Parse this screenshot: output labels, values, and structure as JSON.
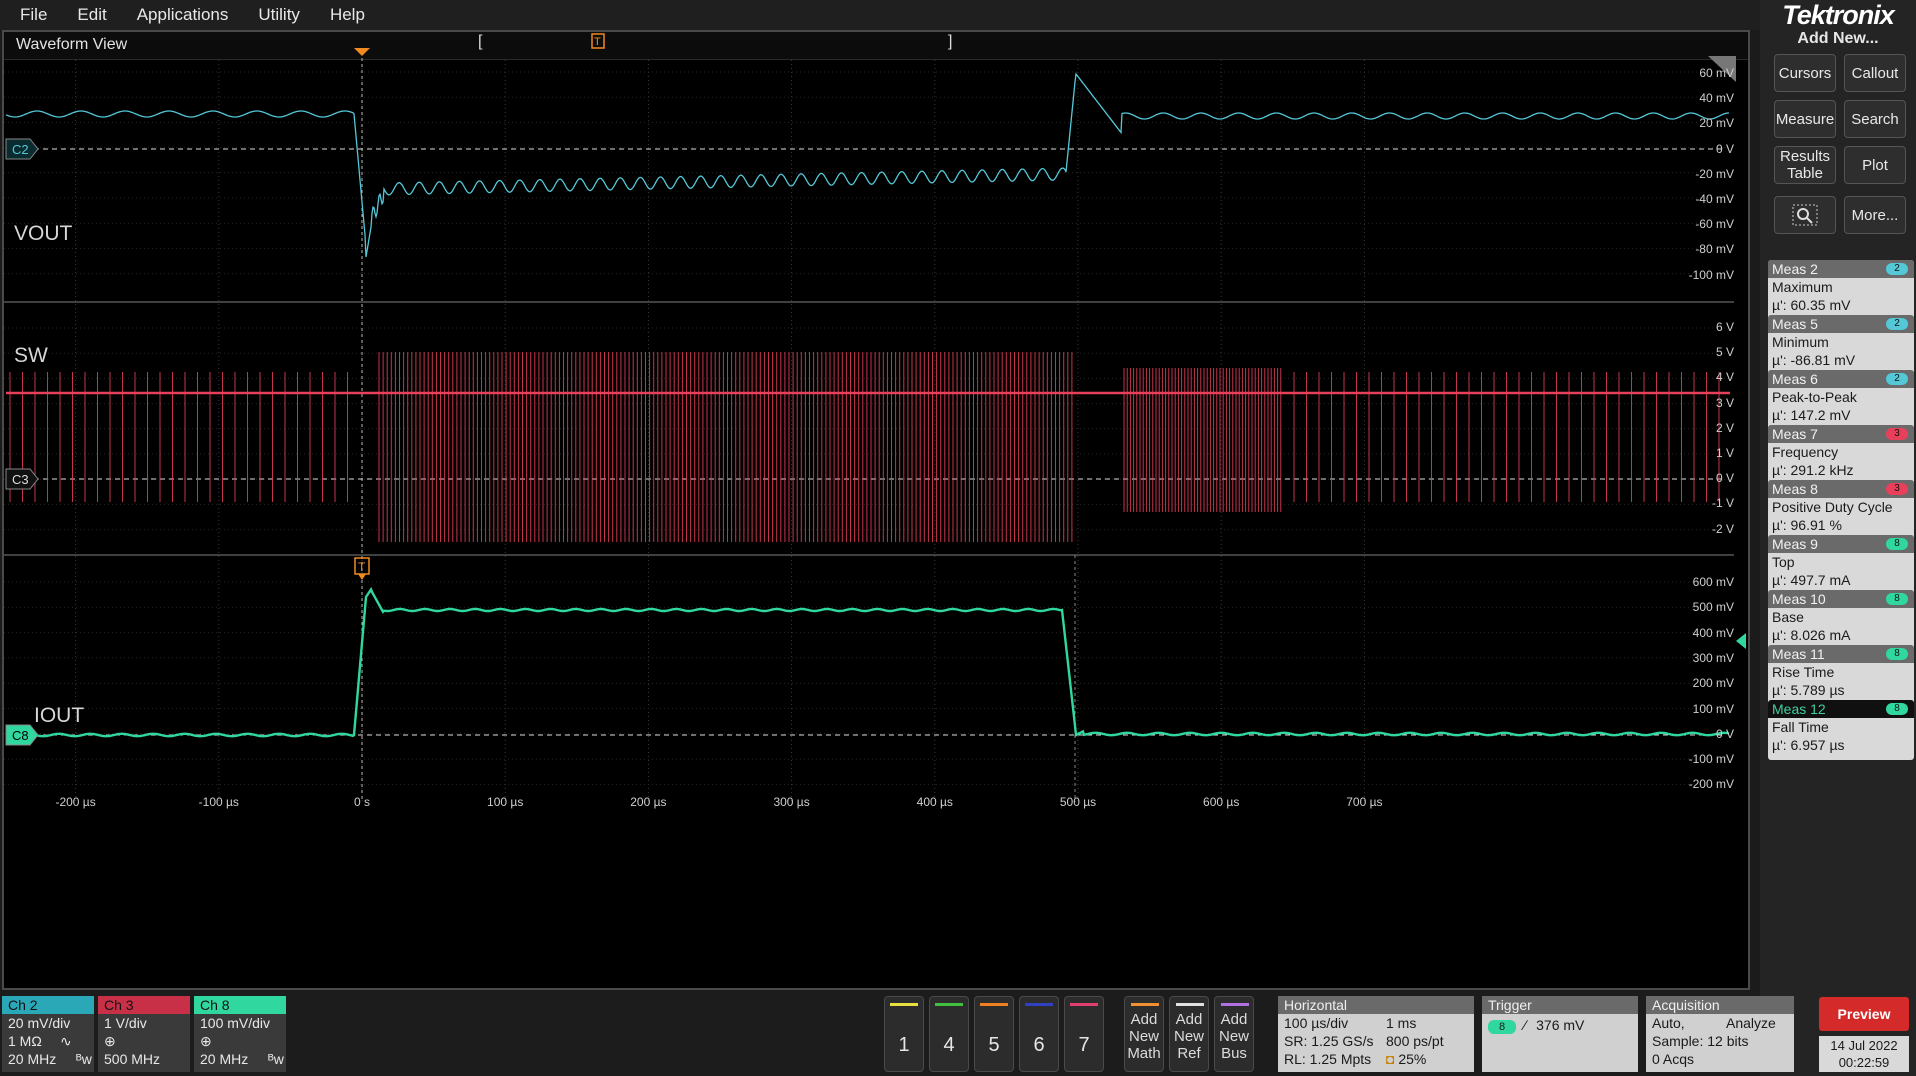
{
  "menu": [
    "File",
    "Edit",
    "Applications",
    "Utility",
    "Help"
  ],
  "waveform_view": {
    "title": "Waveform View",
    "trigger_marker": "T",
    "vout": {
      "label": "VOUT",
      "channel_tag": "C2",
      "color": "#55c8d8",
      "scale": [
        "60 mV",
        "40 mV",
        "20 mV",
        "0 V",
        "-20 mV",
        "-40 mV",
        "-60 mV",
        "-80 mV",
        "-100 mV"
      ]
    },
    "sw": {
      "label": "SW",
      "channel_tag": "C3",
      "color": "#e8405a",
      "scale": [
        "6 V",
        "5 V",
        "4 V",
        "3 V",
        "2 V",
        "1 V",
        "0 V",
        "-1 V",
        "-2 V"
      ]
    },
    "iout": {
      "label": "IOUT",
      "channel_tag": "C8",
      "color": "#30d8a0",
      "scale": [
        "600 mV",
        "500 mV",
        "400 mV",
        "300 mV",
        "200 mV",
        "100 mV",
        "0 V",
        "-100 mV",
        "-200 mV"
      ]
    },
    "time_axis": [
      "-200 µs",
      "-100 µs",
      "0 s",
      "100 µs",
      "200 µs",
      "300 µs",
      "400 µs",
      "500 µs",
      "600 µs",
      "700 µs"
    ]
  },
  "right_panel": {
    "brand": "Tektronix",
    "add_new": "Add New...",
    "buttons": {
      "cursors": "Cursors",
      "callout": "Callout",
      "measure": "Measure",
      "search": "Search",
      "results_table": "Results Table",
      "plot": "Plot",
      "more": "More..."
    },
    "measurements": [
      {
        "name": "Meas 2",
        "type": "Maximum",
        "value": "µ': 60.35 mV",
        "badge": "2",
        "badge_color": "#55c8d8"
      },
      {
        "name": "Meas 5",
        "type": "Minimum",
        "value": "µ': -86.81 mV",
        "badge": "2",
        "badge_color": "#55c8d8"
      },
      {
        "name": "Meas 6",
        "type": "Peak-to-Peak",
        "value": "µ': 147.2 mV",
        "badge": "2",
        "badge_color": "#55c8d8"
      },
      {
        "name": "Meas 7",
        "type": "Frequency",
        "value": "µ': 291.2 kHz",
        "badge": "3",
        "badge_color": "#e8405a"
      },
      {
        "name": "Meas 8",
        "type": "Positive Duty Cycle",
        "value": "µ': 96.91 %",
        "badge": "3",
        "badge_color": "#e8405a"
      },
      {
        "name": "Meas 9",
        "type": "Top",
        "value": "µ': 497.7 mA",
        "badge": "8",
        "badge_color": "#30d8a0"
      },
      {
        "name": "Meas 10",
        "type": "Base",
        "value": "µ': 8.026 mA",
        "badge": "8",
        "badge_color": "#30d8a0"
      },
      {
        "name": "Meas 11",
        "type": "Rise Time",
        "value": "µ': 5.789 µs",
        "badge": "8",
        "badge_color": "#30d8a0"
      },
      {
        "name": "Meas 12",
        "type": "Fall Time",
        "value": "µ': 6.957 µs",
        "badge": "8",
        "badge_color": "#30d8a0"
      }
    ]
  },
  "channels": [
    {
      "name": "Ch 2",
      "color": "#2aa8b8",
      "line1": "20 mV/div",
      "line2": "1 MΩ",
      "line3": "20 MHz",
      "sym2": "∿",
      "sym3": "ᴮw"
    },
    {
      "name": "Ch 3",
      "color": "#c83048",
      "line1": "1 V/div",
      "line2": "⊕",
      "line3": "500 MHz",
      "sym2": "",
      "sym3": ""
    },
    {
      "name": "Ch 8",
      "color": "#30d8a0",
      "line1": "100 mV/div",
      "line2": "⊕",
      "line3": "20 MHz",
      "sym2": "",
      "sym3": "ᴮw"
    }
  ],
  "channel_buttons": [
    {
      "num": "1",
      "color": "#e8e040"
    },
    {
      "num": "4",
      "color": "#40c040"
    },
    {
      "num": "5",
      "color": "#f08020"
    },
    {
      "num": "6",
      "color": "#3040c0"
    },
    {
      "num": "7",
      "color": "#e04070"
    }
  ],
  "add_buttons": [
    {
      "label1": "Add",
      "label2": "New",
      "label3": "Math",
      "color": "#f09030"
    },
    {
      "label1": "Add",
      "label2": "New",
      "label3": "Ref",
      "color": "#e0e0e0"
    },
    {
      "label1": "Add",
      "label2": "New",
      "label3": "Bus",
      "color": "#b070e0"
    }
  ],
  "horizontal": {
    "title": "Horizontal",
    "scale": "100 µs/div",
    "record": "1 ms",
    "sample_rate": "SR: 1.25 GS/s",
    "resolution": "800 ps/pt",
    "record_length": "RL: 1.25 Mpts",
    "position": "25%"
  },
  "trigger": {
    "title": "Trigger",
    "source": "8",
    "level": "376 mV"
  },
  "acquisition": {
    "title": "Acquisition",
    "mode": "Auto,",
    "analyze": "Analyze",
    "sample": "Sample: 12 bits",
    "acqs": "0 Acqs"
  },
  "preview": "Preview",
  "date": "14 Jul 2022",
  "time": "00:22:59"
}
